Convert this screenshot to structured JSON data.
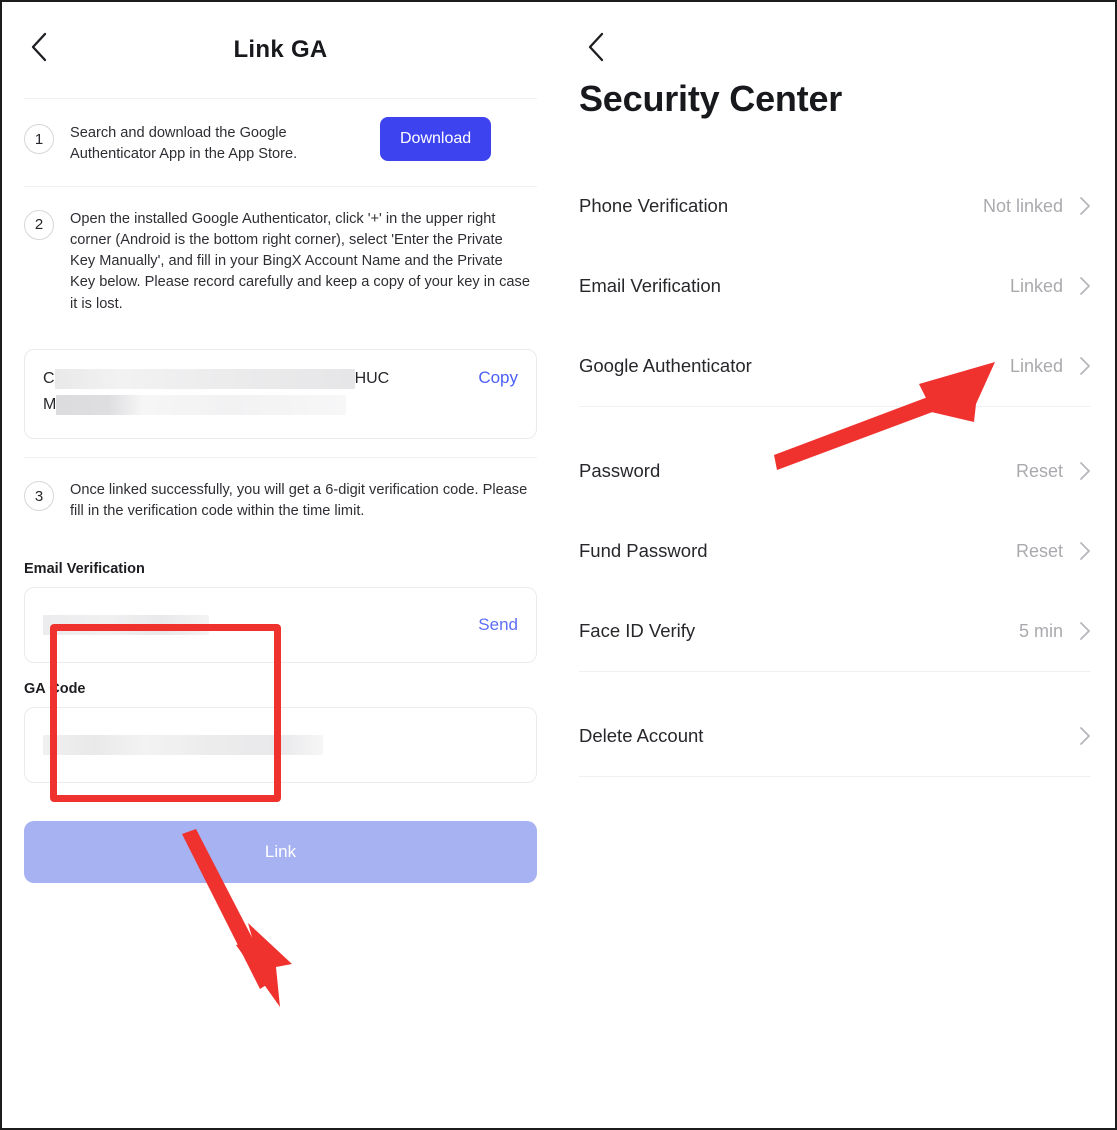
{
  "left_panel": {
    "back_icon": "chevron-left-icon",
    "title": "Link GA",
    "steps": [
      {
        "number": "1",
        "text": "Search and download the Google Authenticator App in the App Store.",
        "button_label": "Download"
      },
      {
        "number": "2",
        "text": "Open the installed Google Authenticator, click '+' in the upper right corner (Android is the bottom right corner), select 'Enter the Private Key Manually', and fill in your BingX Account Name and the Private Key below. Please record carefully and keep a copy of your key in case it is lost."
      },
      {
        "number": "3",
        "text": "Once linked successfully, you will get a 6-digit verification code. Please fill in the verification code within the time limit."
      }
    ],
    "key_card": {
      "line1_prefix": "C",
      "line1_suffix": "HUC",
      "line2_prefix": "M",
      "copy_label": "Copy"
    },
    "email_field": {
      "label": "Email Verification",
      "value": "",
      "placeholder": "",
      "action_label": "Send"
    },
    "ga_field": {
      "label": "GA Code",
      "value": "",
      "placeholder": ""
    },
    "submit_label": "Link"
  },
  "right_panel": {
    "back_icon": "chevron-left-icon",
    "title": "Security Center",
    "rows": [
      {
        "label": "Phone Verification",
        "value": "Not linked"
      },
      {
        "label": "Email Verification",
        "value": "Linked"
      },
      {
        "label": "Google Authenticator",
        "value": "Linked"
      },
      {
        "label": "Password",
        "value": "Reset"
      },
      {
        "label": "Fund Password",
        "value": "Reset"
      },
      {
        "label": "Face ID Verify",
        "value": "5 min"
      },
      {
        "label": "Delete Account",
        "value": ""
      }
    ]
  },
  "annotations": {
    "highlight_box_name": "email-verification-highlight",
    "arrow_left_name": "arrow-pointing-to-link-button",
    "arrow_right_name": "arrow-pointing-to-google-authenticator-linked",
    "color": "#f0322f"
  },
  "colors": {
    "accent_blue": "#3e43f0",
    "link_blue": "#5d6df8",
    "disabled_button": "#a6b2f2",
    "annotation_red": "#f0322f",
    "muted_text": "#a9aaae"
  }
}
